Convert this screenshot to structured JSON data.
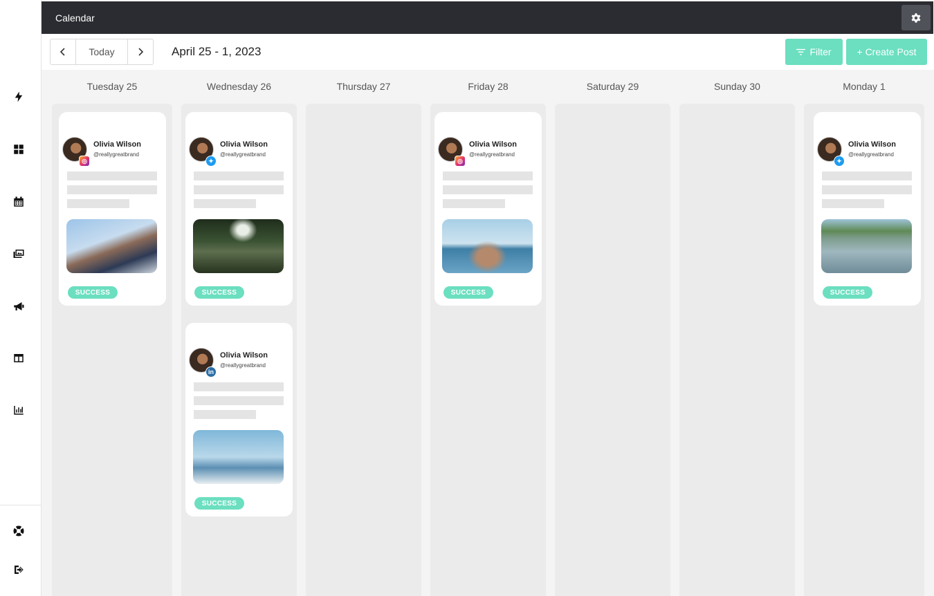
{
  "app": {
    "title": "Calendar"
  },
  "toolbar": {
    "today_label": "Today",
    "prev_icon": "chevron-left-icon",
    "next_icon": "chevron-right-icon",
    "date_range": "April 25 - 1, 2023",
    "filter_label": "Filter",
    "create_label": "+ Create Post",
    "accent_color": "#6bdfc0"
  },
  "sidebar": {
    "icons": [
      "bolt-icon",
      "dashboard-icon",
      "calendar-icon",
      "media-icon",
      "megaphone-icon",
      "layout-icon",
      "analytics-icon",
      "help-icon",
      "logout-icon"
    ]
  },
  "days": [
    {
      "label": "Tuesday 25"
    },
    {
      "label": "Wednesday 26"
    },
    {
      "label": "Thursday 27"
    },
    {
      "label": "Friday 28"
    },
    {
      "label": "Saturday 29"
    },
    {
      "label": "Sunday 30"
    },
    {
      "label": "Monday 1"
    }
  ],
  "posts": [
    {
      "day": 0,
      "name": "Olivia Wilson",
      "handle": "@reallygreatbrand",
      "network": "instagram",
      "status": "SUCCESS",
      "image": "woman-sunglasses-photo"
    },
    {
      "day": 1,
      "name": "Olivia Wilson",
      "handle": "@reallygreatbrand",
      "network": "twitter",
      "status": "SUCCESS",
      "image": "waterfall-photo"
    },
    {
      "day": 1,
      "name": "Olivia Wilson",
      "handle": "@reallygreatbrand",
      "network": "linkedin",
      "status": "SUCCESS",
      "image": "boat-photo"
    },
    {
      "day": 3,
      "name": "Olivia Wilson",
      "handle": "@reallygreatbrand",
      "network": "instagram",
      "status": "SUCCESS",
      "image": "beach-photo"
    },
    {
      "day": 6,
      "name": "Olivia Wilson",
      "handle": "@reallygreatbrand",
      "network": "twitter",
      "status": "SUCCESS",
      "image": "river-hiker-photo"
    }
  ]
}
